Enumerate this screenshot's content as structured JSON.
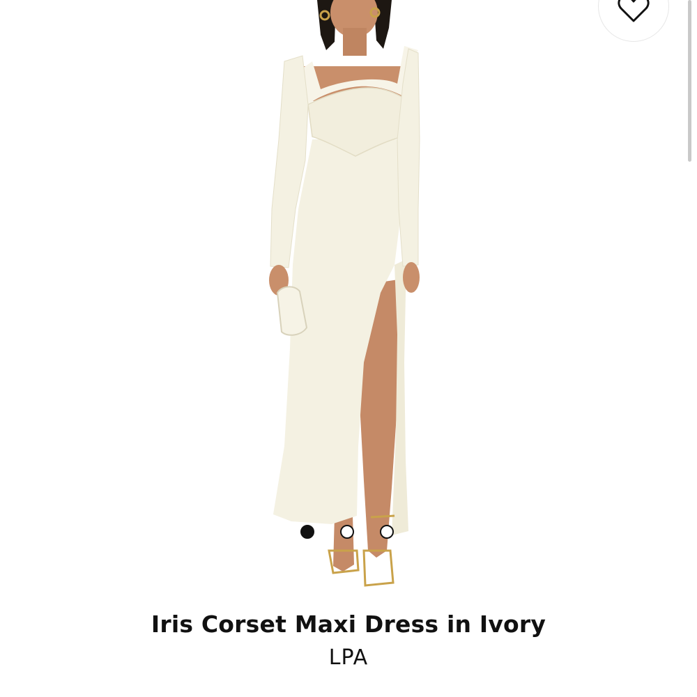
{
  "product": {
    "title": "Iris Corset Maxi Dress in Ivory",
    "brand": "LPA"
  },
  "carousel": {
    "total": 3,
    "active_index": 0
  },
  "icons": {
    "wishlist": "heart-outline-icon"
  },
  "colors": {
    "background": "#ffffff",
    "dress": "#f4f1e2",
    "text": "#111111",
    "skin": "#c98f6b"
  }
}
